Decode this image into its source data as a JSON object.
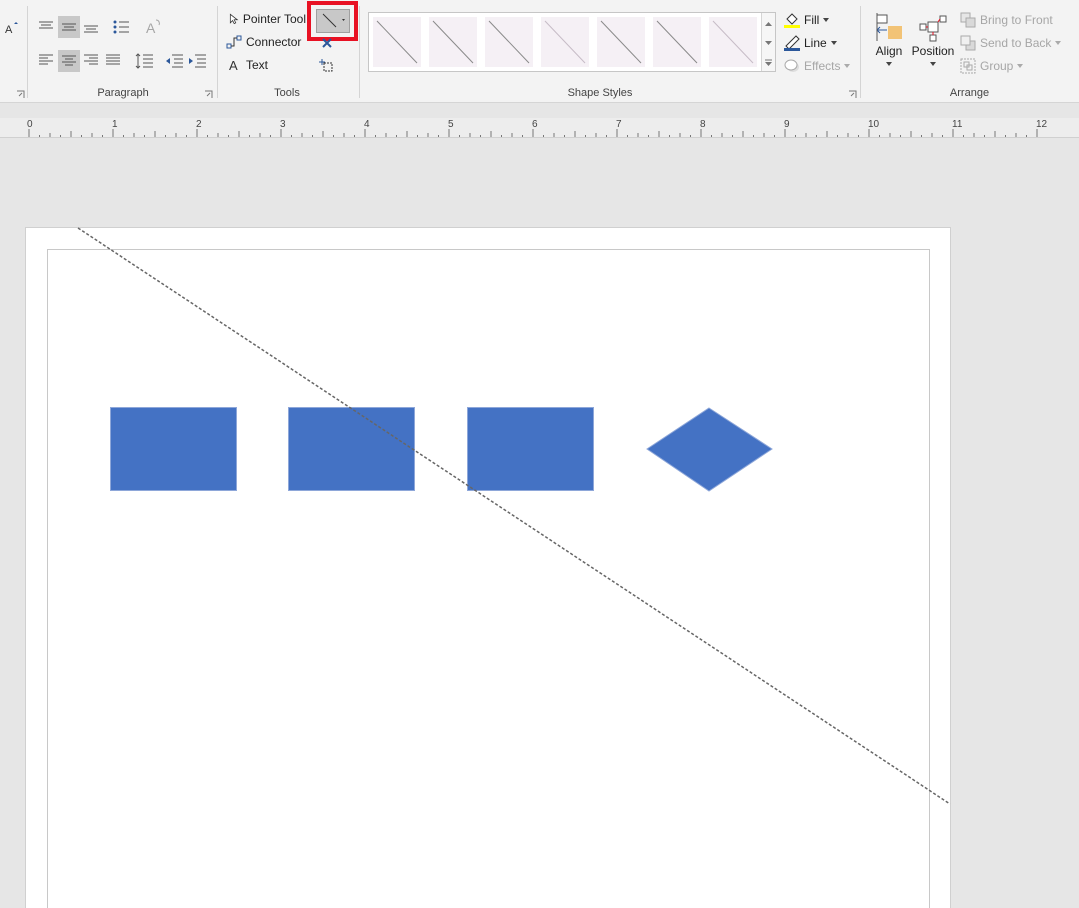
{
  "ribbon": {
    "groups": {
      "paragraph": "Paragraph",
      "tools": "Tools",
      "shape_styles": "Shape Styles",
      "arrange": "Arrange"
    },
    "tools": {
      "pointer_tool": "Pointer Tool",
      "connector": "Connector",
      "text": "Text",
      "line_tool_selected": "line-tool"
    },
    "shape_styles": {
      "fill": "Fill",
      "line": "Line",
      "effects": "Effects",
      "swatch_count": 7
    },
    "arrange": {
      "align": "Align",
      "position": "Position",
      "bring_to_front": "Bring to Front",
      "send_to_back": "Send to Back",
      "group": "Group"
    }
  },
  "ruler": {
    "numbers": [
      "0",
      "1",
      "2",
      "3",
      "4",
      "5",
      "6",
      "7",
      "8",
      "9",
      "10",
      "11",
      "12"
    ]
  },
  "colors": {
    "shape_fill": "#4472c4",
    "highlight": "#e81123",
    "ribbon_bg": "#f3f3f3"
  },
  "icons": [
    "font-color-icon",
    "paragraph-align-icon",
    "bullets-icon",
    "text-direction-icon",
    "indent-icon",
    "pointer-icon",
    "connector-icon",
    "text-tool-icon",
    "line-tool-icon",
    "close-icon",
    "connection-point-icon",
    "fill-icon",
    "line-color-icon",
    "effects-icon",
    "align-icon",
    "position-icon",
    "bring-to-front-icon",
    "send-to-back-icon",
    "group-icon"
  ]
}
